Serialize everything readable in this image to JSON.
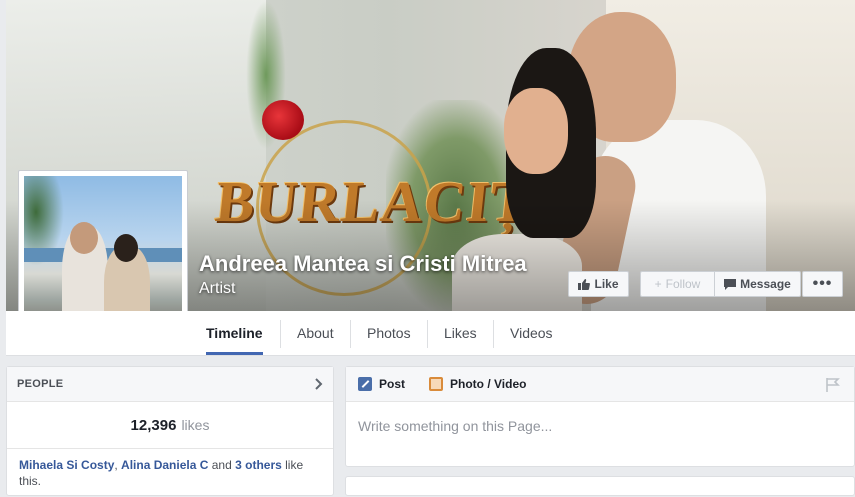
{
  "page": {
    "name": "Andreea Mantea si Cristi Mitrea",
    "category": "Artist",
    "cover_logo": "BURLACIȚA"
  },
  "buttons": {
    "like": "Like",
    "follow": "Follow",
    "message": "Message",
    "more": "•••"
  },
  "nav": {
    "tabs": [
      {
        "label": "Timeline",
        "active": true
      },
      {
        "label": "About"
      },
      {
        "label": "Photos"
      },
      {
        "label": "Likes"
      },
      {
        "label": "Videos"
      }
    ]
  },
  "people": {
    "title": "PEOPLE",
    "likes_count": "12,396",
    "likes_word": "likes",
    "friend1": "Mihaela Si Costy",
    "friend2": "Alina Daniela C",
    "and_text": " and ",
    "others": "3 others",
    "suffix": " like this."
  },
  "composer": {
    "post_label": "Post",
    "photo_label": "Photo / Video",
    "placeholder": "Write something on this Page..."
  },
  "colors": {
    "accent": "#4267b2",
    "link": "#365899",
    "background": "#e9ebee"
  }
}
